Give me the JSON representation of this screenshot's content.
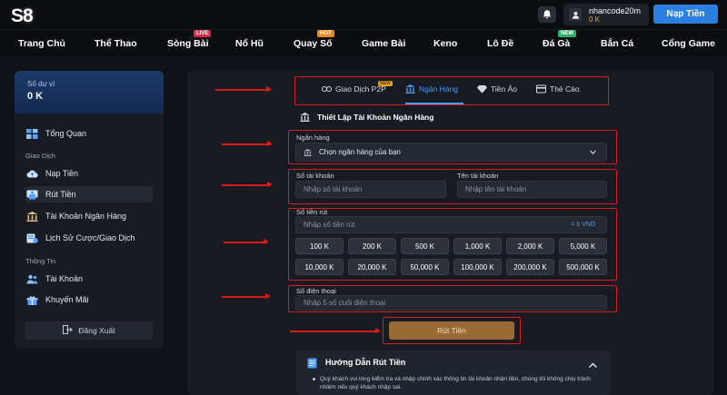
{
  "header": {
    "logo_s": "S",
    "logo_8": "8",
    "username": "nhancode20m",
    "balance": "0 K",
    "deposit_label": "Nạp Tiền"
  },
  "nav": {
    "items": [
      {
        "label": "Trang Chủ",
        "badge": ""
      },
      {
        "label": "Thể Thao",
        "badge": ""
      },
      {
        "label": "Sòng Bài",
        "badge": "LIVE"
      },
      {
        "label": "Nổ Hũ",
        "badge": ""
      },
      {
        "label": "Quay Số",
        "badge": "HOT"
      },
      {
        "label": "Game Bài",
        "badge": ""
      },
      {
        "label": "Keno",
        "badge": ""
      },
      {
        "label": "Lô Đề",
        "badge": ""
      },
      {
        "label": "Đá Gà",
        "badge": "NEW"
      },
      {
        "label": "Bắn Cá",
        "badge": ""
      },
      {
        "label": "Cổng Game",
        "badge": ""
      }
    ]
  },
  "sidebar": {
    "balance_label": "Số dư ví",
    "balance_value": "0 K",
    "overview": "Tổng Quan",
    "section_transactions": "Giao Dịch",
    "deposit": "Nạp Tiền",
    "withdraw": "Rút Tiền",
    "bank_account": "Tài Khoản Ngân Hàng",
    "history": "Lịch Sử Cược/Giao Dịch",
    "section_info": "Thông Tin",
    "account": "Tài Khoản",
    "promo": "Khuyến Mãi",
    "logout": "Đăng Xuất"
  },
  "tabs": {
    "p2p": "Giao Dịch P2P",
    "p2p_badge": "NEW",
    "bank": "Ngân Hàng",
    "crypto": "Tiền Ảo",
    "card": "Thẻ Cào"
  },
  "form": {
    "title": "Thiết Lập Tài Khoản Ngân Hàng",
    "bank_label": "Ngân hàng",
    "bank_value": "Chọn ngân hàng của bạn",
    "account_no_label": "Số tài khoản",
    "account_no_placeholder": "Nhập số tài khoản",
    "account_name_label": "Tên tài khoản",
    "account_name_placeholder": "Nhập tên tài khoản",
    "amount_label": "Số tiền rút",
    "amount_placeholder": "Nhập số tiền rút",
    "amount_suffix": "= 0 VND",
    "amounts": [
      "100 K",
      "200 K",
      "500 K",
      "1,000 K",
      "2,000 K",
      "5,000 K",
      "10,000 K",
      "20,000 K",
      "50,000 K",
      "100,000 K",
      "200,000 K",
      "500,000 K"
    ],
    "phone_label": "Số điện thoại",
    "phone_placeholder": "Nhập 5 số cuối điện thoại",
    "submit": "Rút Tiền"
  },
  "guide": {
    "title": "Hướng Dẫn Rút Tiền",
    "text": "Quý khách vui lòng kiểm tra và nhập chính xác thông tin tài khoản nhận tiền, chúng tôi không chịu trách nhiệm nếu quý khách nhập sai."
  },
  "colors": {
    "accent": "#2a7fe0",
    "highlight_box": "#d81b1b",
    "submit": "#9a6a35",
    "balance": "#f5a623"
  }
}
